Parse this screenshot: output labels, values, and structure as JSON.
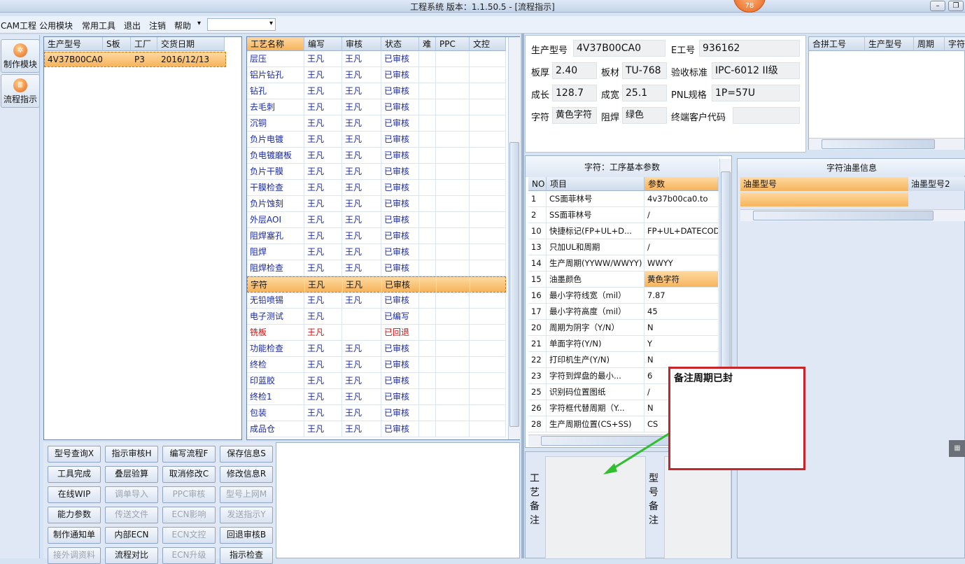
{
  "window": {
    "title": "工程系统  版本：1.1.50.5 - [流程指示]",
    "badge": "78"
  },
  "menu": {
    "items": [
      "CAM工程",
      "公用模块",
      "常用工具",
      "退出",
      "注销",
      "帮助"
    ],
    "help_arrow": "▾",
    "combo_arrow": "▾"
  },
  "nav": {
    "items": [
      {
        "label": "制作模块",
        "icon": "gear-icon"
      },
      {
        "label": "流程指示",
        "icon": "flow-icon"
      }
    ]
  },
  "orders": {
    "headers": [
      "生产型号",
      "S板",
      "工厂",
      "交货日期"
    ],
    "rows": [
      {
        "model": "4V37B00CA0",
        "s": "",
        "factory": "P3",
        "date": "2016/12/13"
      }
    ]
  },
  "process": {
    "headers": [
      "工艺名称",
      "编写",
      "审核",
      "状态",
      "难",
      "PPC",
      "文控"
    ],
    "rows": [
      {
        "name": "层压",
        "writer": "王凡",
        "reviewer": "王凡",
        "status": "已审核"
      },
      {
        "name": "铝片钻孔",
        "writer": "王凡",
        "reviewer": "王凡",
        "status": "已审核"
      },
      {
        "name": "钻孔",
        "writer": "王凡",
        "reviewer": "王凡",
        "status": "已审核"
      },
      {
        "name": "去毛刺",
        "writer": "王凡",
        "reviewer": "王凡",
        "status": "已审核"
      },
      {
        "name": "沉铜",
        "writer": "王凡",
        "reviewer": "王凡",
        "status": "已审核"
      },
      {
        "name": "负片电镀",
        "writer": "王凡",
        "reviewer": "王凡",
        "status": "已审核"
      },
      {
        "name": "负电镀磨板",
        "writer": "王凡",
        "reviewer": "王凡",
        "status": "已审核"
      },
      {
        "name": "负片干膜",
        "writer": "王凡",
        "reviewer": "王凡",
        "status": "已审核"
      },
      {
        "name": "干膜检查",
        "writer": "王凡",
        "reviewer": "王凡",
        "status": "已审核"
      },
      {
        "name": "负片蚀刻",
        "writer": "王凡",
        "reviewer": "王凡",
        "status": "已审核"
      },
      {
        "name": "外层AOI",
        "writer": "王凡",
        "reviewer": "王凡",
        "status": "已审核"
      },
      {
        "name": "阻焊塞孔",
        "writer": "王凡",
        "reviewer": "王凡",
        "status": "已审核"
      },
      {
        "name": "阻焊",
        "writer": "王凡",
        "reviewer": "王凡",
        "status": "已审核"
      },
      {
        "name": "阻焊检查",
        "writer": "王凡",
        "reviewer": "王凡",
        "status": "已审核"
      },
      {
        "name": "字符",
        "writer": "王凡",
        "reviewer": "王凡",
        "status": "已审核",
        "selected": true
      },
      {
        "name": "无铅喷锡",
        "writer": "王凡",
        "reviewer": "王凡",
        "status": "已审核"
      },
      {
        "name": "电子测试",
        "writer": "王凡",
        "reviewer": "",
        "status": "已编写"
      },
      {
        "name": "铣板",
        "writer": "王凡",
        "reviewer": "",
        "status": "已回退",
        "red": true
      },
      {
        "name": "功能检查",
        "writer": "王凡",
        "reviewer": "王凡",
        "status": "已审核"
      },
      {
        "name": "终检",
        "writer": "王凡",
        "reviewer": "王凡",
        "status": "已审核"
      },
      {
        "name": "印蓝胶",
        "writer": "王凡",
        "reviewer": "王凡",
        "status": "已审核"
      },
      {
        "name": "终检1",
        "writer": "王凡",
        "reviewer": "王凡",
        "status": "已审核"
      },
      {
        "name": "包装",
        "writer": "王凡",
        "reviewer": "王凡",
        "status": "已审核"
      },
      {
        "name": "成品仓",
        "writer": "王凡",
        "reviewer": "王凡",
        "status": "已审核"
      }
    ]
  },
  "info": {
    "model_label": "生产型号",
    "model": "4V37B00CA0",
    "eno_label": "E工号",
    "eno": "936162",
    "thickness_label": "板厚",
    "thickness": "2.40",
    "material_label": "板材",
    "material": "TU-768",
    "standard_label": "验收标准",
    "standard": "IPC-6012 II级",
    "length_label": "成长",
    "length": "128.7",
    "width_label": "成宽",
    "width": "25.1",
    "pnl_label": "PNL规格",
    "pnl": "1P=57U",
    "char_label": "字符",
    "char": "黄色字符",
    "mask_label": "阻焊",
    "mask": "绿色",
    "customer_label": "终端客户代码",
    "customer": ""
  },
  "merge": {
    "headers": [
      "合拼工号",
      "生产型号",
      "周期",
      "字符"
    ]
  },
  "params": {
    "title": "字符：工序基本参数",
    "headers": [
      "NO",
      "项目",
      "参数"
    ],
    "rows": [
      {
        "no": "1",
        "item": "CS面菲林号",
        "value": "4v37b00ca0.to"
      },
      {
        "no": "2",
        "item": "SS面菲林号",
        "value": "/"
      },
      {
        "no": "10",
        "item": "快捷标记(FP+UL+D...",
        "value": "FP+UL+DATECODE"
      },
      {
        "no": "13",
        "item": "只加UL和周期",
        "value": "/"
      },
      {
        "no": "14",
        "item": "生产周期(YYWW/WWYY)",
        "value": "WWYY"
      },
      {
        "no": "15",
        "item": "油墨颜色",
        "value": "黄色字符",
        "selected": true
      },
      {
        "no": "16",
        "item": "最小字符线宽（mil）",
        "value": "7.87"
      },
      {
        "no": "17",
        "item": "最小字符高度（mil）",
        "value": "45"
      },
      {
        "no": "20",
        "item": "周期为阴字（Y/N）",
        "value": "N"
      },
      {
        "no": "21",
        "item": "单面字符(Y/N)",
        "value": "Y"
      },
      {
        "no": "22",
        "item": "打印机生产(Y/N)",
        "value": "N"
      },
      {
        "no": "23",
        "item": "字符到焊盘的最小...",
        "value": "6"
      },
      {
        "no": "25",
        "item": "识别码位置图纸",
        "value": "/"
      },
      {
        "no": "26",
        "item": "字符框代替周期（Y...",
        "value": "N"
      },
      {
        "no": "28",
        "item": "生产周期位置(CS+SS)",
        "value": "CS"
      }
    ]
  },
  "ink": {
    "title": "字符油墨信息",
    "headers": [
      "油墨型号",
      "油墨型号2"
    ]
  },
  "buttons": [
    [
      {
        "label": "型号查询X",
        "enabled": true
      },
      {
        "label": "指示审核H",
        "enabled": true
      },
      {
        "label": "编写流程F",
        "enabled": true
      },
      {
        "label": "保存信息S",
        "enabled": true
      }
    ],
    [
      {
        "label": "工具完成",
        "enabled": true
      },
      {
        "label": "叠层验算",
        "enabled": true
      },
      {
        "label": "取消修改C",
        "enabled": true
      },
      {
        "label": "修改信息R",
        "enabled": true
      }
    ],
    [
      {
        "label": "在线WIP",
        "enabled": true
      },
      {
        "label": "调单导入",
        "enabled": false
      },
      {
        "label": "PPC审核",
        "enabled": false
      },
      {
        "label": "型号上网M",
        "enabled": false
      }
    ],
    [
      {
        "label": "能力参数",
        "enabled": true
      },
      {
        "label": "传送文件",
        "enabled": false
      },
      {
        "label": "ECN影响",
        "enabled": false
      },
      {
        "label": "发送指示Y",
        "enabled": false
      }
    ],
    [
      {
        "label": "制作通知单",
        "enabled": true
      },
      {
        "label": "内部ECN",
        "enabled": true
      },
      {
        "label": "ECN文控",
        "enabled": false
      },
      {
        "label": "回退审核B",
        "enabled": true
      }
    ],
    [
      {
        "label": "接外调资料",
        "enabled": false
      },
      {
        "label": "流程对比",
        "enabled": true
      },
      {
        "label": "ECN升级",
        "enabled": false
      },
      {
        "label": "指示检查",
        "enabled": true
      }
    ]
  ],
  "remarks": {
    "process_label": "工艺备注",
    "model_label": "型号备注"
  },
  "callout": {
    "text": "备注周期已封",
    "border_color": "#c8252b",
    "arrow_color": "#2fbf2f"
  }
}
